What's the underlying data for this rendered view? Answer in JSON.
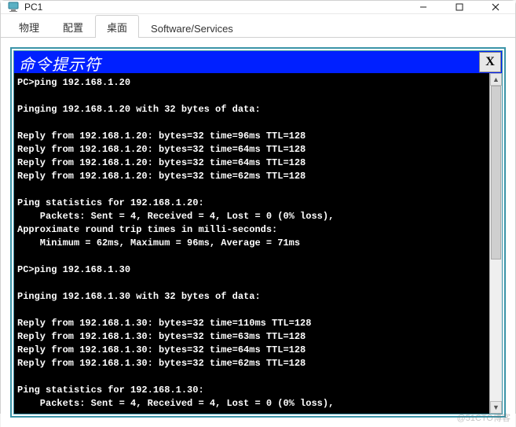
{
  "window": {
    "title": "PC1",
    "icon_name": "pc-icon"
  },
  "win_controls": {
    "minimize": "minimize",
    "maximize": "maximize",
    "close": "close"
  },
  "tabs": {
    "items": [
      {
        "label": "物理"
      },
      {
        "label": "配置"
      },
      {
        "label": "桌面"
      },
      {
        "label": "Software/Services"
      }
    ],
    "active_index": 2
  },
  "console": {
    "title": "命令提示符",
    "close_label": "X",
    "lines": [
      "PC>ping 192.168.1.20",
      "",
      "Pinging 192.168.1.20 with 32 bytes of data:",
      "",
      "Reply from 192.168.1.20: bytes=32 time=96ms TTL=128",
      "Reply from 192.168.1.20: bytes=32 time=64ms TTL=128",
      "Reply from 192.168.1.20: bytes=32 time=64ms TTL=128",
      "Reply from 192.168.1.20: bytes=32 time=62ms TTL=128",
      "",
      "Ping statistics for 192.168.1.20:",
      "    Packets: Sent = 4, Received = 4, Lost = 0 (0% loss),",
      "Approximate round trip times in milli-seconds:",
      "    Minimum = 62ms, Maximum = 96ms, Average = 71ms",
      "",
      "PC>ping 192.168.1.30",
      "",
      "Pinging 192.168.1.30 with 32 bytes of data:",
      "",
      "Reply from 192.168.1.30: bytes=32 time=110ms TTL=128",
      "Reply from 192.168.1.30: bytes=32 time=63ms TTL=128",
      "Reply from 192.168.1.30: bytes=32 time=64ms TTL=128",
      "Reply from 192.168.1.30: bytes=32 time=62ms TTL=128",
      "",
      "Ping statistics for 192.168.1.30:",
      "    Packets: Sent = 4, Received = 4, Lost = 0 (0% loss),"
    ]
  },
  "watermark": "@51CTO博客"
}
